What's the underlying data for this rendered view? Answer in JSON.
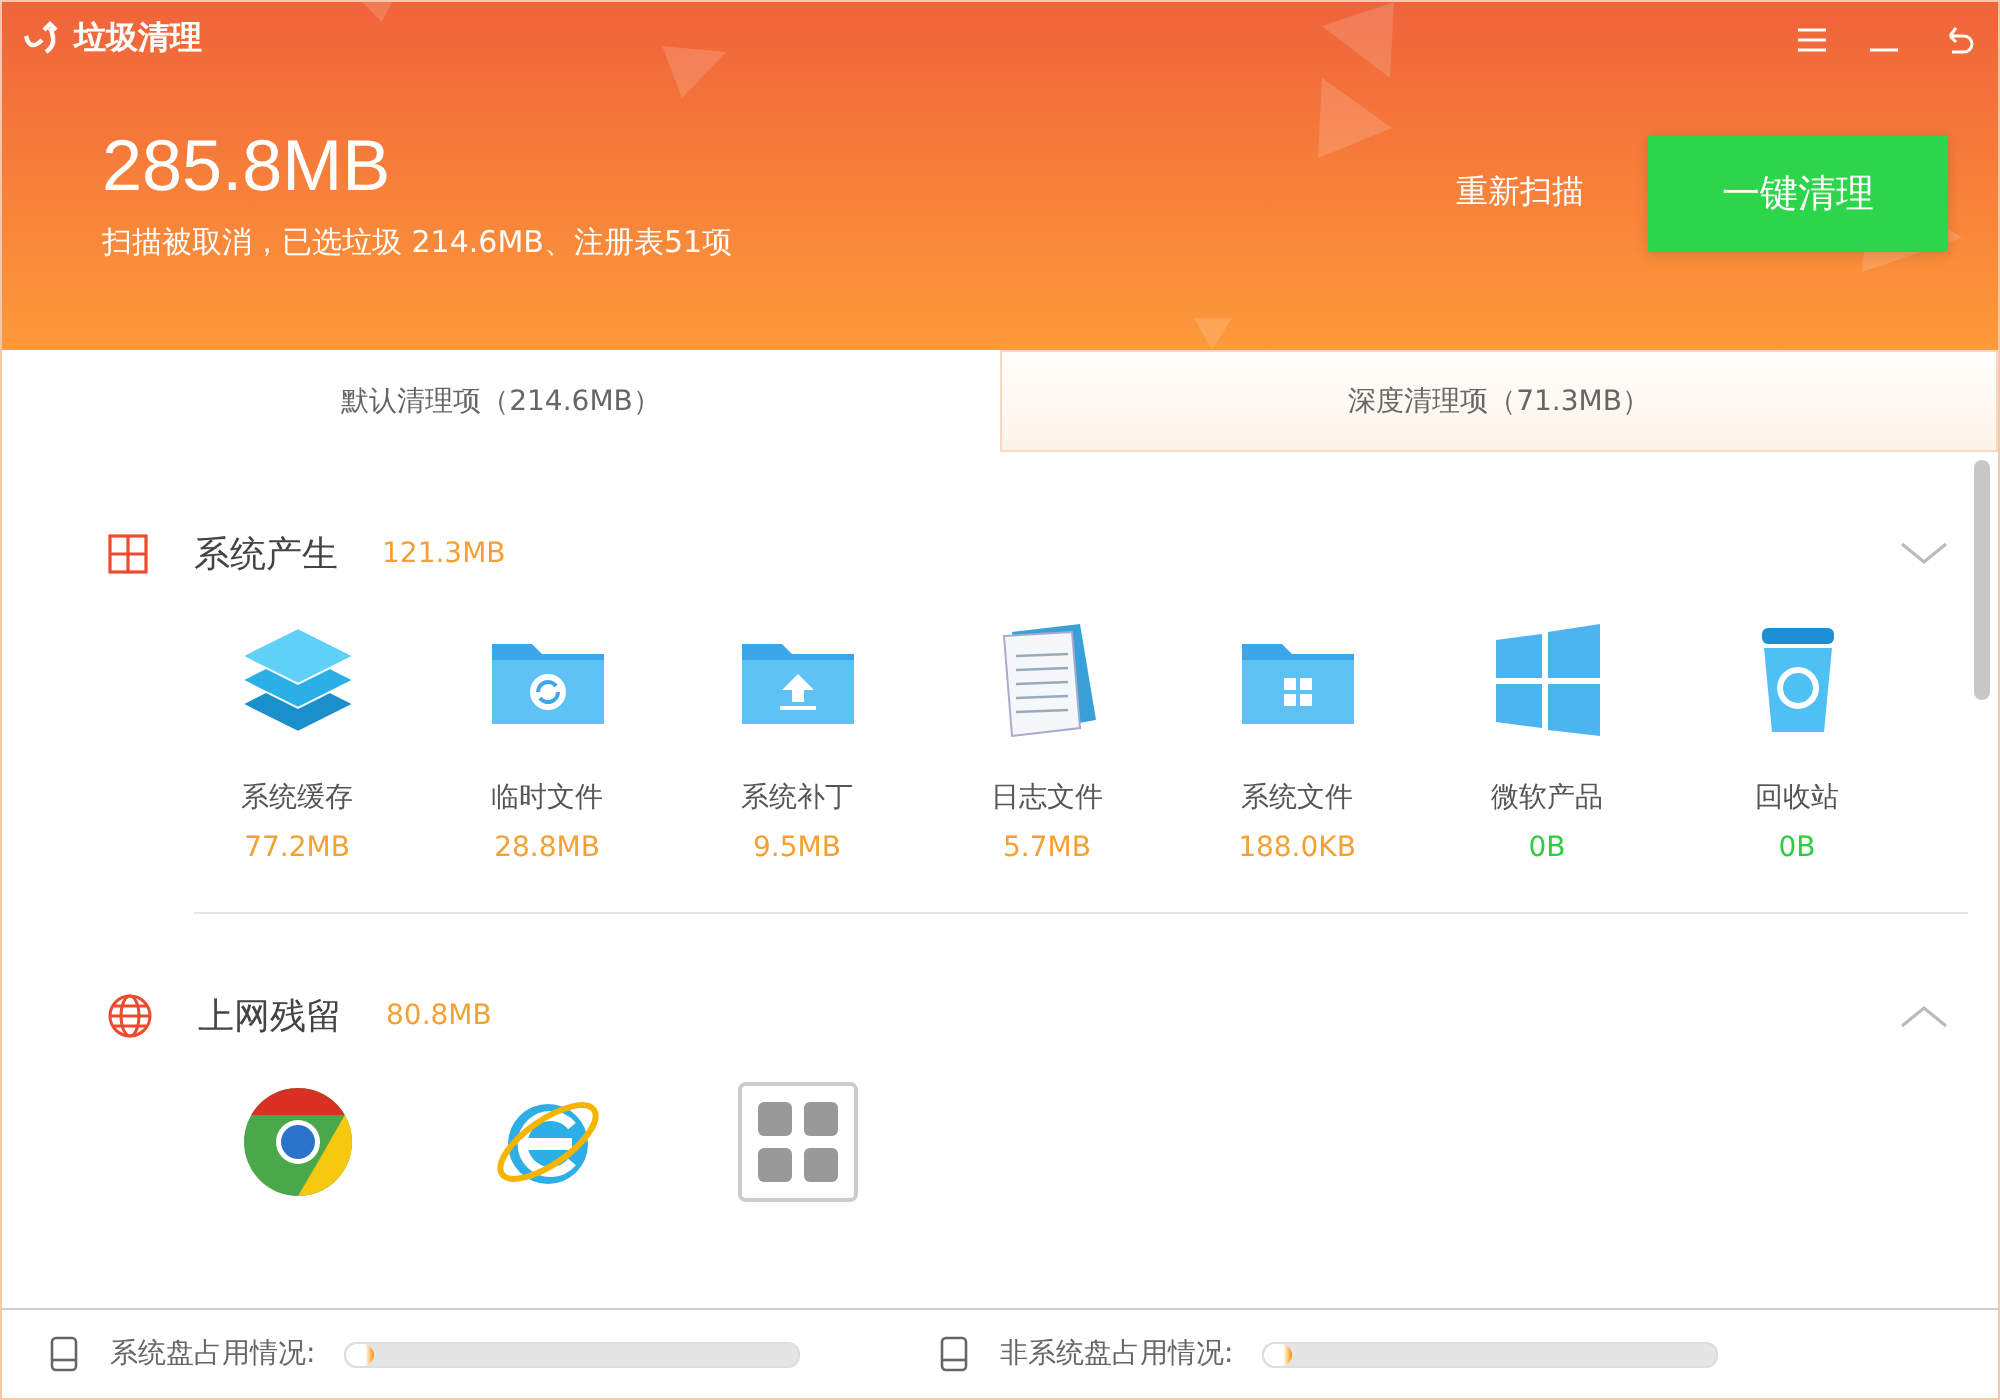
{
  "window": {
    "title": "垃圾清理"
  },
  "summary": {
    "total": "285.8MB",
    "status": "扫描被取消，已选垃圾 214.6MB、注册表51项"
  },
  "actions": {
    "rescan": "重新扫描",
    "clean": "一键清理"
  },
  "tabs": [
    {
      "label": "默认清理项（214.6MB）",
      "selected": true
    },
    {
      "label": "深度清理项（71.3MB）",
      "selected": false
    }
  ],
  "sections": [
    {
      "kind": "system",
      "title": "系统产生",
      "size": "121.3MB",
      "chevron_up": false,
      "items": [
        {
          "kind": "layers",
          "name": "系统缓存",
          "size": "77.2MB",
          "color": "#f5a030"
        },
        {
          "kind": "folder-refresh",
          "name": "临时文件",
          "size": "28.8MB",
          "color": "#f5a030"
        },
        {
          "kind": "folder-upload",
          "name": "系统补丁",
          "size": "9.5MB",
          "color": "#f5a030"
        },
        {
          "kind": "notepad",
          "name": "日志文件",
          "size": "5.7MB",
          "color": "#f5a030"
        },
        {
          "kind": "folder-windows",
          "name": "系统文件",
          "size": "188.0KB",
          "color": "#f5a030"
        },
        {
          "kind": "windows",
          "name": "微软产品",
          "size": "0B",
          "color": "#2ecc40"
        },
        {
          "kind": "recycle",
          "name": "回收站",
          "size": "0B",
          "color": "#2ecc40"
        }
      ]
    },
    {
      "kind": "web",
      "title": "上网残留",
      "size": "80.8MB",
      "chevron_up": true,
      "items": [
        {
          "kind": "chrome"
        },
        {
          "kind": "ie"
        },
        {
          "kind": "apps"
        }
      ]
    }
  ],
  "footer": [
    {
      "label": "系统盘占用情况:",
      "level": 0.03
    },
    {
      "label": "非系统盘占用情况:",
      "level": 0.02
    }
  ]
}
